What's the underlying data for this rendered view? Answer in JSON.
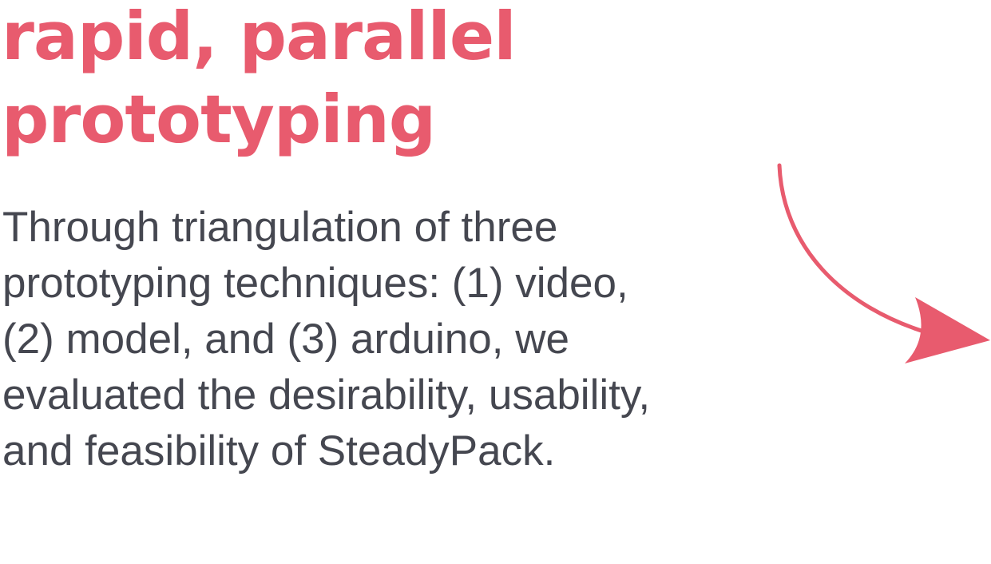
{
  "heading": {
    "lines": [
      "rapid, parallel",
      "prototyping"
    ]
  },
  "body": {
    "lines": [
      "Through triangulation of three",
      "prototyping techniques: (1) video,",
      "(2) model, and (3) arduino, we",
      "evaluated the desirability, usability,",
      "and feasibility of SteadyPack."
    ]
  },
  "icons": {
    "arrow": "curved-arrow-right-icon"
  },
  "colors": {
    "accent": "#e85b6e",
    "text": "#454750",
    "background": "#ffffff"
  }
}
